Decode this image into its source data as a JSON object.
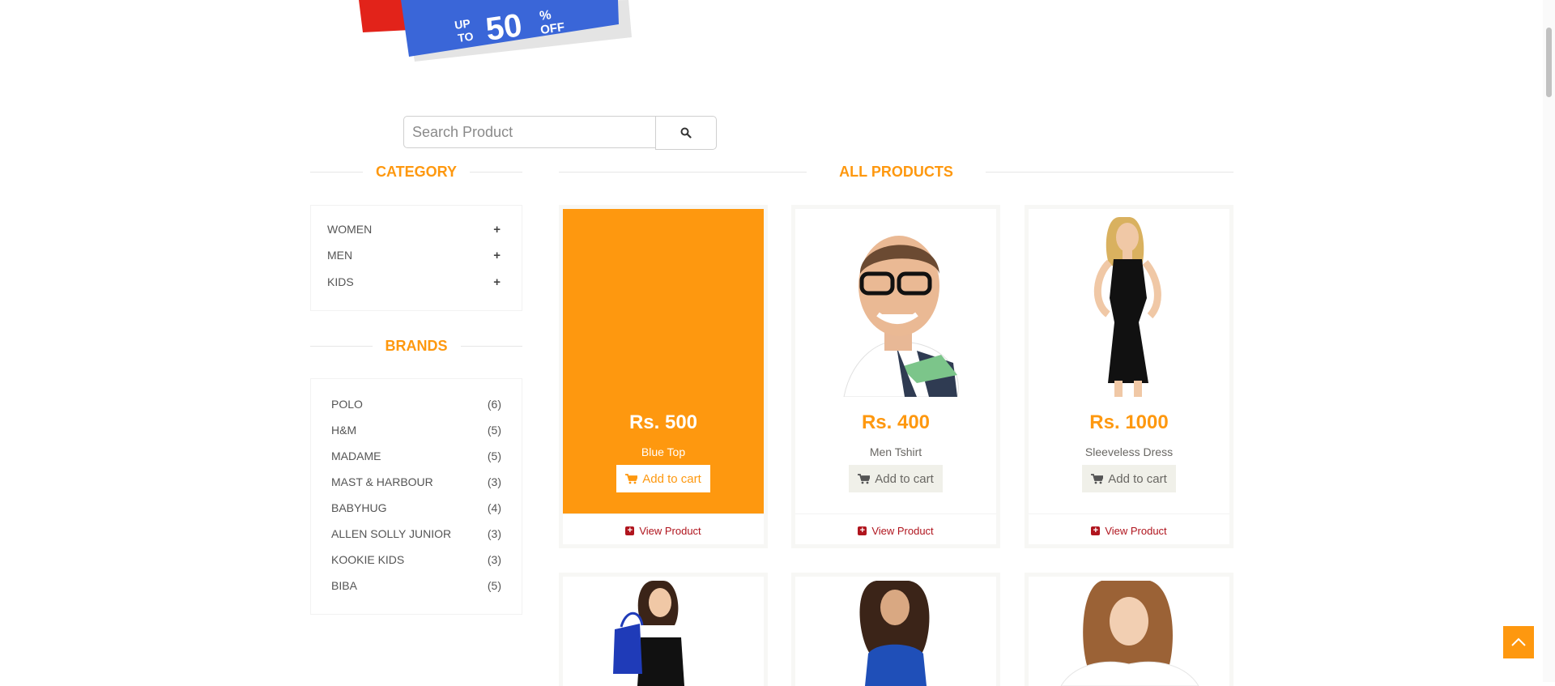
{
  "banner": {
    "line1": "UP",
    "line2": "TO",
    "percent": "50",
    "percent_sign": "%",
    "off": "OFF"
  },
  "search": {
    "placeholder": "Search Product"
  },
  "category": {
    "title": "CATEGORY",
    "items": [
      {
        "label": "WOMEN",
        "toggle": "+"
      },
      {
        "label": "MEN",
        "toggle": "+"
      },
      {
        "label": "KIDS",
        "toggle": "+"
      }
    ]
  },
  "brands": {
    "title": "BRANDS",
    "items": [
      {
        "name": "POLO",
        "count": "(6)"
      },
      {
        "name": "H&M",
        "count": "(5)"
      },
      {
        "name": "MADAME",
        "count": "(5)"
      },
      {
        "name": "MAST & HARBOUR",
        "count": "(3)"
      },
      {
        "name": "BABYHUG",
        "count": "(4)"
      },
      {
        "name": "ALLEN SOLLY JUNIOR",
        "count": "(3)"
      },
      {
        "name": "KOOKIE KIDS",
        "count": "(3)"
      },
      {
        "name": "BIBA",
        "count": "(5)"
      }
    ]
  },
  "products": {
    "title": "ALL PRODUCTS",
    "add_to_cart": "Add to cart",
    "view_product": "View Product",
    "items": [
      {
        "price": "Rs. 500",
        "name": "Blue Top"
      },
      {
        "price": "Rs. 400",
        "name": "Men Tshirt"
      },
      {
        "price": "Rs. 1000",
        "name": "Sleeveless Dress"
      }
    ]
  },
  "colors": {
    "accent": "#fe980f",
    "link": "#b0151e",
    "button_bg": "#f0f0e9"
  }
}
